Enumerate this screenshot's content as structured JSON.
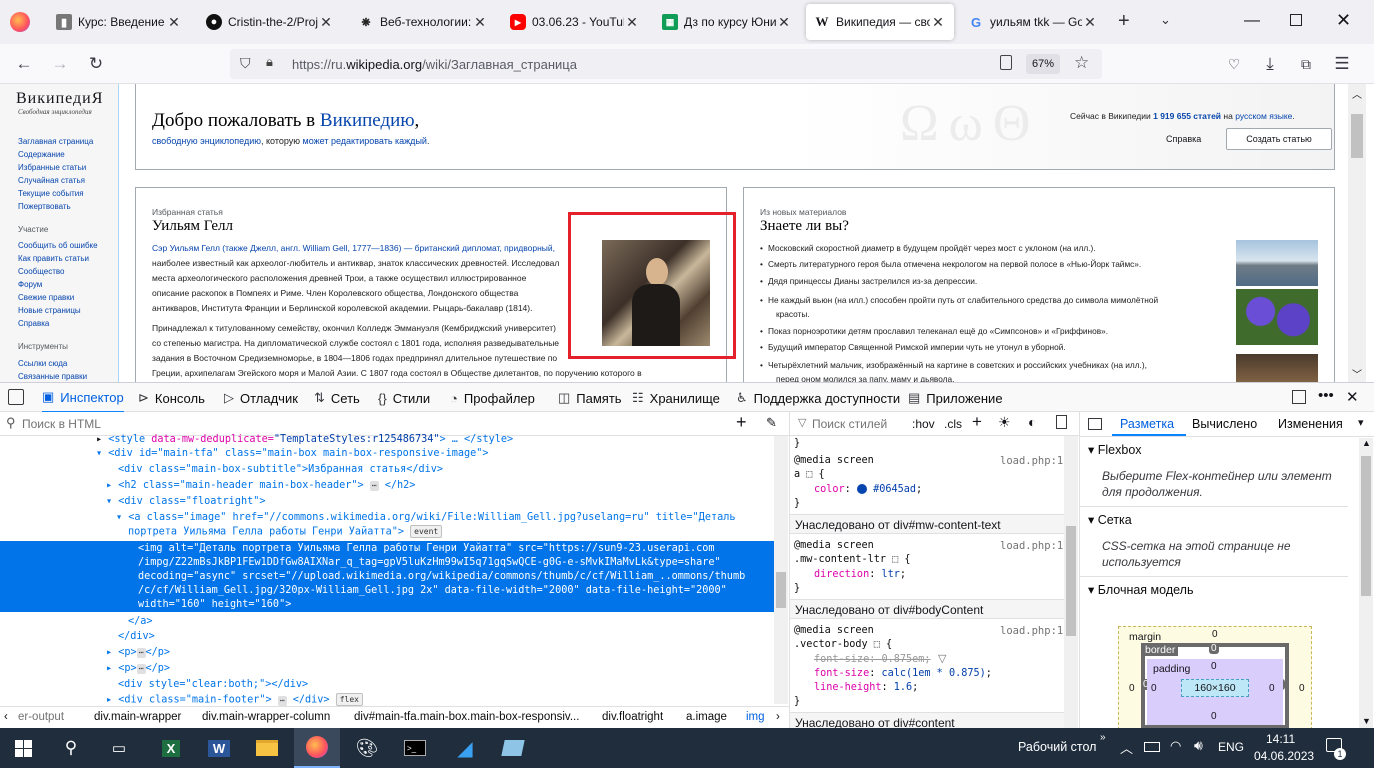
{
  "tabs": [
    {
      "title": "Курс: Введение в",
      "icon": "book-icon",
      "active": false
    },
    {
      "title": "Cristin-the-2/Proje",
      "icon": "github-icon",
      "active": false
    },
    {
      "title": "Веб-технологии: ",
      "icon": "openai-icon",
      "active": false
    },
    {
      "title": "03.06.23 - YouTub",
      "icon": "youtube-icon",
      "active": false
    },
    {
      "title": "Дз по курсу Юни",
      "icon": "sheets-icon",
      "active": false
    },
    {
      "title": "Википедия — сво",
      "icon": "wikipedia-icon",
      "active": true
    },
    {
      "title": "уильям tkk — Goo",
      "icon": "google-icon",
      "active": false
    }
  ],
  "nav": {
    "url_prefix": "https://ru.",
    "url_domain": "wikipedia.org",
    "url_path": "/wiki/Заглавная_страница",
    "zoom": "67%"
  },
  "wiki": {
    "logo": "ВикипедиЯ",
    "logo_sub": "Свободная энциклопедия",
    "sidebar_links": [
      "Заглавная страница",
      "Содержание",
      "Избранные статьи",
      "Случайная статья",
      "Текущие события",
      "Пожертвовать"
    ],
    "sidebar_head2": "Участие",
    "sidebar_links2": [
      "Сообщить об ошибке",
      "Как править статьи",
      "Сообщество",
      "Форум",
      "Свежие правки",
      "Новые страницы",
      "Справка"
    ],
    "sidebar_head3": "Инструменты",
    "sidebar_links3": [
      "Ссылки сюда",
      "Связанные правки"
    ],
    "welcome_prefix": "Добро пожаловать в ",
    "welcome_link": "Википедию",
    "welcome_suffix": ",",
    "welcome_sub_1": "свободную энциклопедию",
    "welcome_sub_2": ", которую ",
    "welcome_sub_3": "может редактировать каждый",
    "welcome_sub_4": ".",
    "stat_prefix": "Сейчас в Википедии ",
    "stat_count": "1 919 655 статей",
    "stat_mid": " на ",
    "stat_lang": "русском языке",
    "stat_end": ".",
    "help_link": "Справка",
    "create_button": "Создать статью",
    "featured_sub": "Избранная статья",
    "featured_head": "Уильям Гелл",
    "featured_lines": [
      "Сэр Уильям Гелл (также Джелл, англ. William Gell, 1777—1836) — британский дипломат, придворный,",
      "наиболее известный как археолог-любитель и антиквар, знаток классических древностей. Исследовал",
      "места археологического расположения древней Трои, а также осуществил иллюстрированное",
      "описание раскопок в Помпеях и Риме. Член Королевского общества, Лондонского общества",
      "антикваров, Института Франции и Берлинской королевской академии. Рыцарь-бакалавр (1814)."
    ],
    "featured_lines2": [
      "Принадлежал к титулованному семейству, окончил Колледж Эммануэля (Кембриджский университет)",
      "со степенью магистра. На дипломатической службе состоял с 1801 года, исполняя разведывательные",
      "задания в Восточном Средиземноморье, в 1804—1806 годах предпринял длительное путешествие по",
      "Греции, архипелагам Эгейского моря и Малой Азии. С 1807 года состоял в Обществе дилетантов, по поручению которого в"
    ],
    "dyk_sub": "Из новых материалов",
    "dyk_head": "Знаете ли вы?",
    "dyk_items": [
      "Московский скоростной диаметр в будущем пройдёт через мост с уклоном (на илл.).",
      "Смерть литературного героя была отмечена некрологом на первой полосе в «Нью-Йорк таймс».",
      "Дядя принцессы Дианы застрелился из-за депрессии.",
      "Не каждый вьюн (на илл.) способен пройти путь от слабительного средства до символа мимолётной",
      "красоты.",
      "Показ порноэротики детям прославил телеканал ещё до «Симпсонов» и «Гриффинов».",
      "Будущий император Священной Римской империи чуть не утонул в уборной.",
      "Четырёхлетний мальчик, изображённый на картине в советских и российских учебниках (на илл.),",
      "перед оном молился за папу, маму и дьявола."
    ]
  },
  "devtools": {
    "tabs": [
      {
        "label": "Инспектор",
        "icon": "inspector-icon"
      },
      {
        "label": "Консоль",
        "icon": "console-icon"
      },
      {
        "label": "Отладчик",
        "icon": "debugger-icon"
      },
      {
        "label": "Сеть",
        "icon": "network-icon"
      },
      {
        "label": "Стили",
        "icon": "style-editor-icon"
      },
      {
        "label": "Профайлер",
        "icon": "profiler-icon"
      },
      {
        "label": "Память",
        "icon": "memory-icon"
      },
      {
        "label": "Хранилище",
        "icon": "storage-icon"
      },
      {
        "label": "Поддержка доступности",
        "icon": "accessibility-icon"
      },
      {
        "label": "Приложение",
        "icon": "application-icon"
      }
    ],
    "search_html_placeholder": "Поиск в HTML",
    "search_styles_placeholder": "Поиск стилей",
    "hov": ":hov",
    "cls": ".cls",
    "layout_tabs": [
      "Разметка",
      "Вычислено",
      "Изменения"
    ],
    "flexbox_head": "Flexbox",
    "flexbox_note_1": "Выберите Flex-контейнер или элемент",
    "flexbox_note_2": "для продолжения.",
    "grid_head": "Сетка",
    "grid_note_1": "CSS-сетка на этой странице не",
    "grid_note_2": "используется",
    "boxmodel_head": "Блочная модель",
    "bm_margin": "margin",
    "bm_border": "border",
    "bm_padding": "padding",
    "bm_size": "160×160",
    "bm_zero": "0",
    "event_badge": "event",
    "flex_badge": "flex",
    "inherit_1": "Унаследовано от div#mw-content-text",
    "inherit_2": "Унаследовано от div#bodyContent",
    "inherit_3": "Унаследовано от div#content",
    "file_ref": "load.php:1",
    "media_screen": "@media screen",
    "sel_a": "a",
    "prop_color": "color",
    "val_color": "#0645ad",
    "sel_mw": ".mw-content-ltr",
    "prop_direction": "direction",
    "val_direction": "ltr",
    "sel_vector": ".vector-body",
    "prop_fontsize": "font-size",
    "val_fontsize_old": "0.875em",
    "val_fontsize_new": "calc(1em * 0.875)",
    "prop_lineheight": "line-height",
    "val_lineheight": "1.6",
    "crumbs": [
      "er-output",
      "div.main-wrapper",
      "div.main-wrapper-column",
      "div#main-tfa.main-box.main-box-responsiv...",
      "div.floatright",
      "a.image",
      "img"
    ],
    "html_lines": {
      "l0_tag": "<style",
      "l0_attr": " data-mw-deduplicate=",
      "l0_val": "\"TemplateStyles:r125486734\"",
      "l0_end": "> … </style>",
      "l1": "<div id=\"main-tfa\" class=\"main-box main-box-responsive-image\">",
      "l2": "<div class=\"main-box-subtitle\">Избранная статья</div>",
      "l3": "<h2 class=\"main-header main-box-header\">",
      "l3_end": "</h2>",
      "l4": "<div class=\"floatright\">",
      "l5": "<a class=\"image\" href=\"//commons.wikimedia.org/wiki/File:William_Gell.jpg?uselang=ru\" title=\"Деталь",
      "l6": "портрета Уильяма Гелла работы Генри Уайатта\">",
      "sel1": "<img alt=\"Деталь портрета Уильяма Гелла работы Генри Уайатта\" src=\"https://sun9-23.userapi.com",
      "sel2": "/impg/Z22mBsJkBP1FEw1DDfGw8AIXNar_q_tag=gpV5luKzHm99wI5q71gqSwQCE-g0G-e-sMvkIMaMvLk&type=share\"",
      "sel3": "decoding=\"async\" srcset=\"//upload.wikimedia.org/wikipedia/commons/thumb/c/cf/William_..ommons/thumb",
      "sel4": "/c/cf/William_Gell.jpg/320px-William_Gell.jpg 2x\" data-file-width=\"2000\" data-file-height=\"2000\"",
      "sel5": "width=\"160\" height=\"160\">",
      "l7": "</a>",
      "l8": "</div>",
      "l9": "<p>",
      "l9_end": "</p>",
      "l10": "<p>",
      "l10_end": "</p>",
      "l11": "<div style=\"clear:both;\"></div>",
      "l12": "<div class=\"main-footer\">",
      "l12_end": "</div>"
    }
  },
  "taskbar": {
    "desktop_label": "Рабочий стол",
    "lang": "ENG",
    "time": "14:11",
    "date": "04.06.2023",
    "notif_count": "1"
  }
}
